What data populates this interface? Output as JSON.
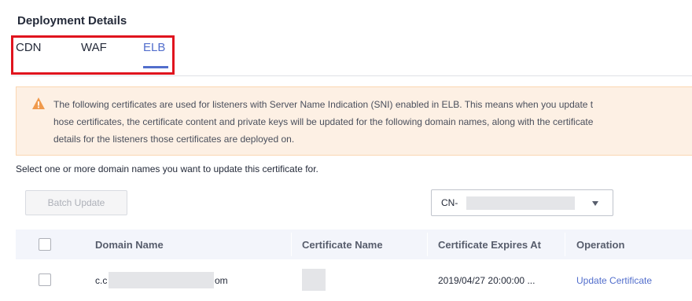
{
  "section": {
    "title": "Deployment Details"
  },
  "tabs": [
    {
      "label": "CDN",
      "active": false
    },
    {
      "label": "WAF",
      "active": false
    },
    {
      "label": "ELB",
      "active": true
    }
  ],
  "alert": {
    "icon": "warning-icon",
    "line1": "The following certificates are used for listeners with Server Name Indication (SNI) enabled in ELB. This means when you update t",
    "line2": "hose certificates, the certificate content and private keys will be updated for the following domain names, along with the certificate",
    "line3": "details for the listeners those certificates are deployed on."
  },
  "instruction": "Select one or more domain names you want to update this certificate for.",
  "toolbar": {
    "batch_update_label": "Batch Update",
    "region_select_value": "CN-"
  },
  "table": {
    "columns": [
      "Domain Name",
      "Certificate Name",
      "Certificate Expires At",
      "Operation"
    ],
    "rows": [
      {
        "domain_prefix": "c.c",
        "domain_suffix": "om",
        "certificate_name": "",
        "expires_at": "2019/04/27 20:00:00 ...",
        "operation": "Update Certificate"
      }
    ]
  },
  "colors": {
    "accent": "#526ecc",
    "warning": "#f66f6a",
    "highlight": "#e0141e"
  }
}
